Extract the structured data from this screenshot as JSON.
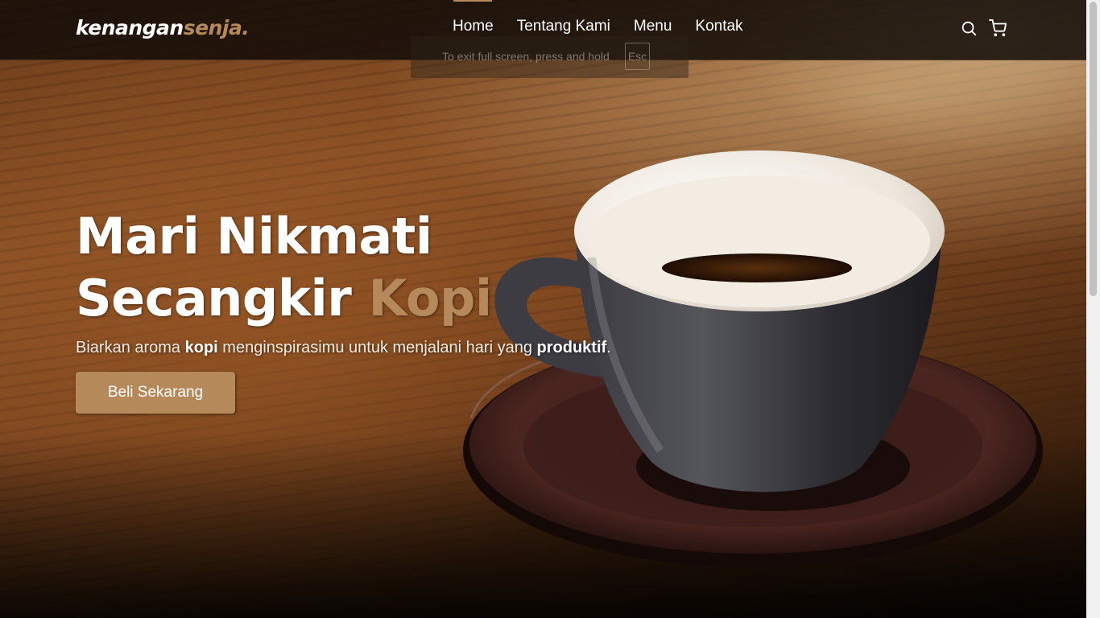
{
  "brand": {
    "logo_main": "kenangan",
    "logo_accent": "senja."
  },
  "nav": {
    "items": [
      {
        "label": "Home"
      },
      {
        "label": "Tentang Kami"
      },
      {
        "label": "Menu"
      },
      {
        "label": "Kontak"
      }
    ],
    "active": "Home",
    "icons": [
      "search-icon",
      "shopping-cart-icon"
    ]
  },
  "fullscreen_toast": {
    "message": "To exit full screen, press and hold",
    "key": "Esc"
  },
  "hero": {
    "title_line1": "Mari Nikmati",
    "title_line2": "Secangkir",
    "title_accent": "Kopi",
    "subtitle_part1": "Biarkan aroma ",
    "subtitle_bold1": "kopi",
    "subtitle_part2": " menginspirasimu untuk menjalani hari yang ",
    "subtitle_bold2": "produktif",
    "subtitle_part3": ".",
    "cta_label": "Beli Sekarang"
  },
  "colors": {
    "accent": "#b6895b",
    "navbar_bg": "#120c08",
    "text": "#ffffff"
  }
}
